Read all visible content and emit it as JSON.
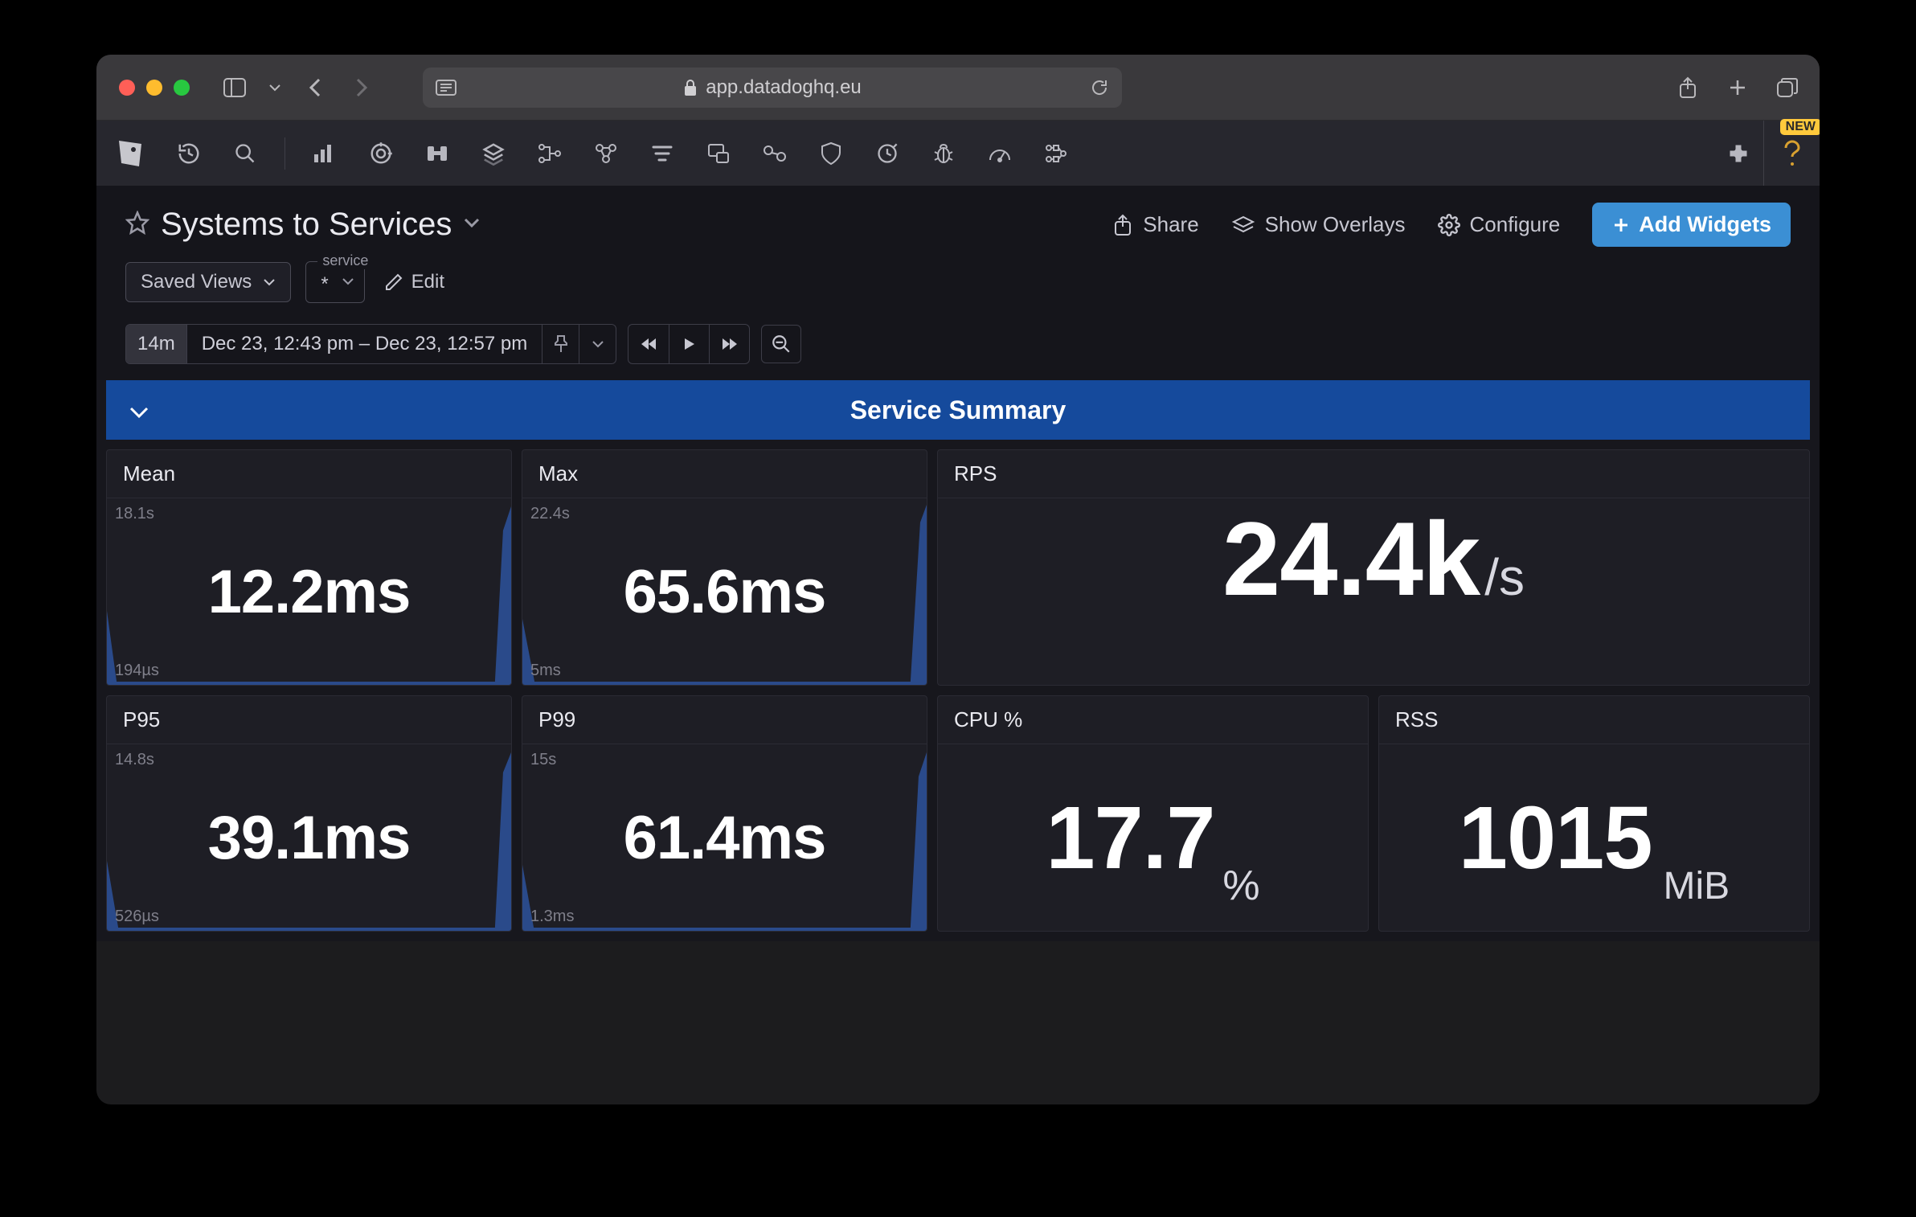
{
  "browser": {
    "url_display": "app.datadoghq.eu"
  },
  "nav": {
    "help_badge": "NEW"
  },
  "dashboard": {
    "title": "Systems to Services",
    "actions": {
      "share": "Share",
      "overlays": "Show Overlays",
      "configure": "Configure",
      "add_widgets": "Add Widgets"
    },
    "saved_views_label": "Saved Views",
    "service_filter": {
      "legend": "service",
      "value": "*"
    },
    "edit_label": "Edit",
    "time": {
      "badge": "14m",
      "range": "Dec 23, 12:43 pm – Dec 23, 12:57 pm"
    }
  },
  "summary": {
    "section_title": "Service Summary",
    "tiles": {
      "mean": {
        "label": "Mean",
        "value": "12.2",
        "unit": "ms",
        "axis_top": "18.1s",
        "axis_bot": "194µs"
      },
      "max": {
        "label": "Max",
        "value": "65.6",
        "unit": "ms",
        "axis_top": "22.4s",
        "axis_bot": "5ms"
      },
      "rps": {
        "label": "RPS",
        "value": "24.4k",
        "unit": "/s"
      },
      "p95": {
        "label": "P95",
        "value": "39.1",
        "unit": "ms",
        "axis_top": "14.8s",
        "axis_bot": "526µs"
      },
      "p99": {
        "label": "P99",
        "value": "61.4",
        "unit": "ms",
        "axis_top": "15s",
        "axis_bot": "1.3ms"
      },
      "cpu": {
        "label": "CPU %",
        "value": "17.7",
        "unit": "%"
      },
      "rss": {
        "label": "RSS",
        "value": "1015",
        "unit": "MiB"
      }
    }
  }
}
